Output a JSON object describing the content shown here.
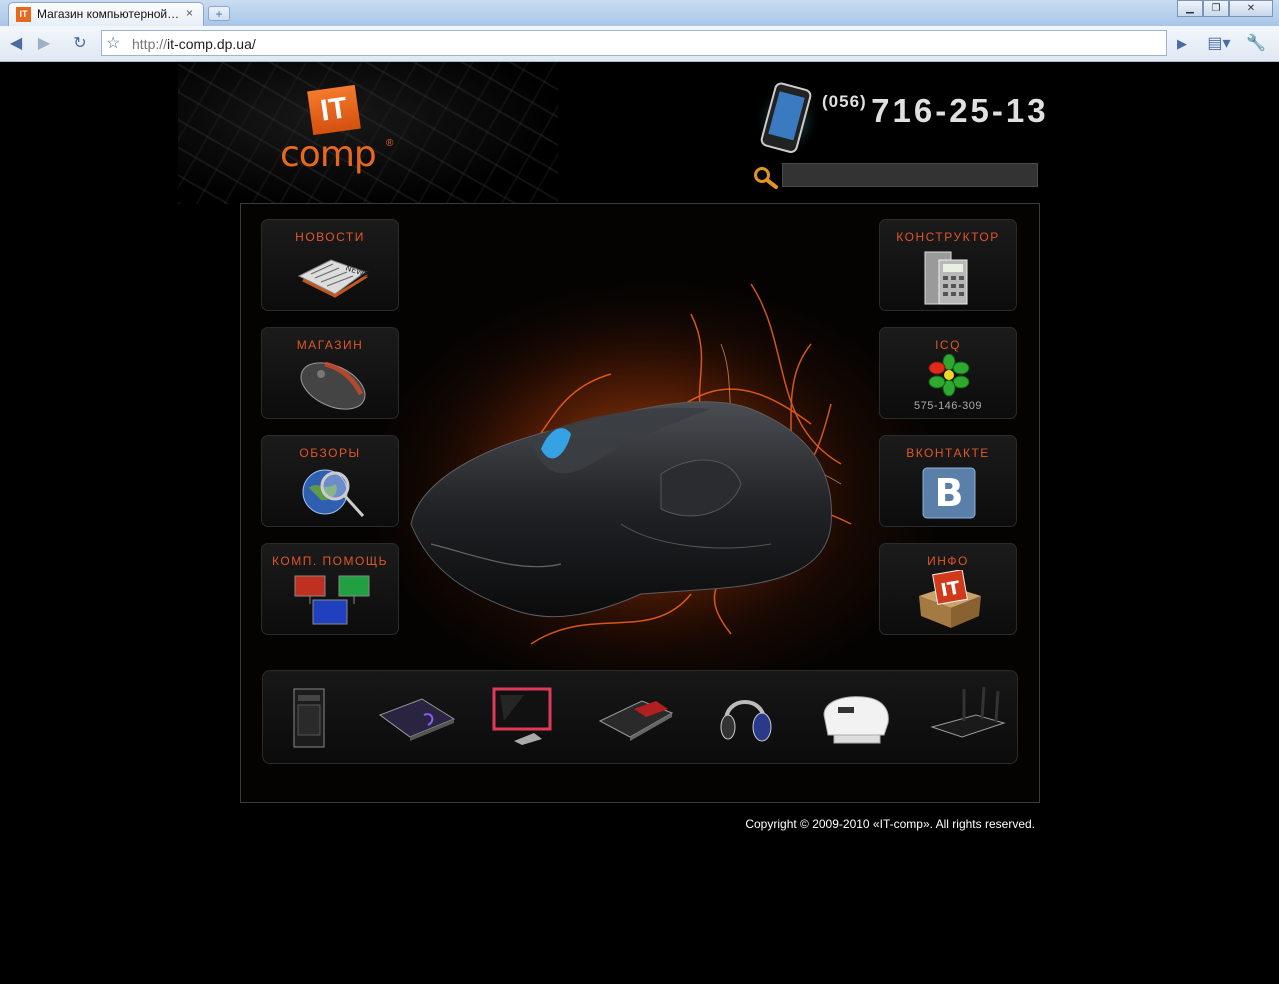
{
  "browser": {
    "tab_title": "Магазин компьютерной…",
    "tab_close": "×",
    "new_tab": "+",
    "url_protocol": "http://",
    "url_rest": "it-comp.dp.ua/",
    "window_controls": [
      "minimize-icon",
      "restore-icon",
      "close-icon"
    ]
  },
  "header": {
    "logo_it": "IT",
    "logo_comp": "comp",
    "logo_reg": "®",
    "phone_code": "(056)",
    "phone_number": "716-25-13",
    "search_value": ""
  },
  "left_menu": [
    {
      "label": "НОВОСТИ",
      "icon": "newspaper-icon"
    },
    {
      "label": "МАГАЗИН",
      "icon": "mouse-icon"
    },
    {
      "label": "ОБЗОРЫ",
      "icon": "globe-magnifier-icon"
    },
    {
      "label": "КОМП. ПОМОЩЬ",
      "icon": "network-monitors-icon"
    }
  ],
  "right_menu": [
    {
      "label": "КОНСТРУКТОР",
      "icon": "calculator-icon"
    },
    {
      "label": "ICQ",
      "icon": "icq-flower-icon",
      "sub": "575-146-309"
    },
    {
      "label": "ВКОНТАКТЕ",
      "icon": "vk-icon"
    },
    {
      "label": "ИНФО",
      "icon": "it-box-icon"
    }
  ],
  "products": [
    "pc-case-icon",
    "laptop-icon",
    "monitor-icon",
    "graphics-card-icon",
    "headphones-icon",
    "printer-icon",
    "router-icon"
  ],
  "footer": {
    "copyright": "Copyright © 2009-2010 «IT-comp». All rights reserved."
  },
  "colors": {
    "accent": "#e0552a",
    "brand_orange": "#e8691d",
    "background": "#000000"
  }
}
